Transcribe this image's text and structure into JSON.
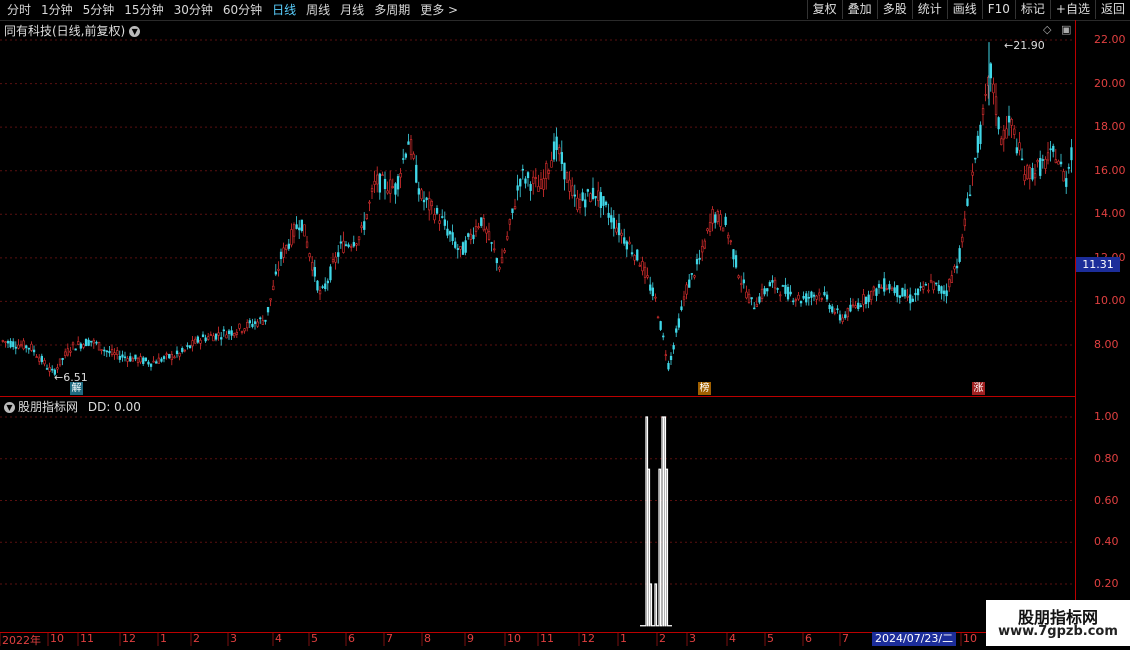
{
  "toolbar": {
    "periods": [
      "分时",
      "1分钟",
      "5分钟",
      "15分钟",
      "30分钟",
      "60分钟",
      "日线",
      "周线",
      "月线",
      "多周期",
      "更多 >"
    ],
    "active_period": "日线",
    "actions": [
      "复权",
      "叠加",
      "多股",
      "统计",
      "画线",
      "F10",
      "标记",
      "+自选",
      "返回"
    ]
  },
  "chart_title": "同有科技(日线,前复权)",
  "price_axis": [
    "22.00",
    "20.00",
    "18.00",
    "16.00",
    "14.00",
    "12.00",
    "10.00",
    "8.00"
  ],
  "current_price": "11.31",
  "peak_label": "21.90",
  "low_label": "6.51",
  "markers": {
    "jie": "解",
    "bang": "榜",
    "zhang": "涨"
  },
  "indicator": {
    "title": "股朋指标网",
    "value_label": "DD: 0.00",
    "axis": [
      "1.00",
      "0.80",
      "0.60",
      "0.40",
      "0.20"
    ]
  },
  "date_axis": {
    "labels": [
      "2022年",
      "10",
      "11",
      "12",
      "1",
      "2",
      "3",
      "4",
      "5",
      "6",
      "7",
      "8",
      "9",
      "10",
      "11",
      "12",
      "1",
      "2",
      "3",
      "4",
      "5",
      "6",
      "7",
      "10"
    ],
    "selected_date": "2024/07/23/二"
  },
  "watermark": {
    "line1": "股朋指标网",
    "line2": "www.7gpzb.com"
  },
  "colors": {
    "up": "#e03030",
    "down": "#40d8e8",
    "axis": "#b00000",
    "accent": "#1c2d9a"
  }
}
